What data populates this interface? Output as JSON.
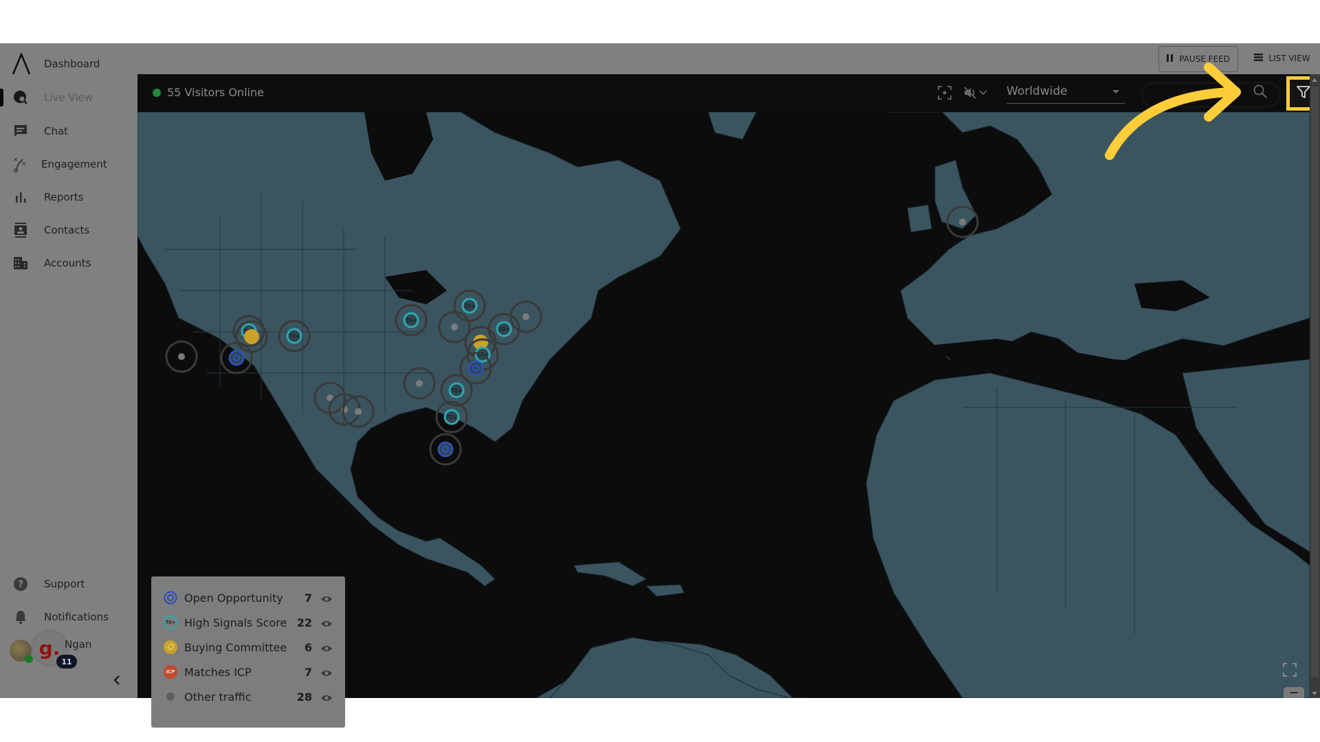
{
  "sidebar": {
    "items": [
      {
        "label": "Dashboard",
        "icon": "logo-icon"
      },
      {
        "label": "Live View",
        "icon": "globe-search-icon",
        "active": true
      },
      {
        "label": "Chat",
        "icon": "chat-icon"
      },
      {
        "label": "Engagement",
        "icon": "strategy-icon"
      },
      {
        "label": "Reports",
        "icon": "bar-chart-icon"
      },
      {
        "label": "Contacts",
        "icon": "contact-card-icon"
      },
      {
        "label": "Accounts",
        "icon": "building-icon"
      }
    ],
    "bottom_items": [
      {
        "label": "Support",
        "icon": "help-icon"
      },
      {
        "label": "Notifications",
        "icon": "bell-icon"
      }
    ],
    "user": {
      "name": "Ngan",
      "brand_letter": "g.",
      "notification_count": "11"
    },
    "collapse_icon": "chevron-left-icon"
  },
  "toolbar": {
    "pause_label": "PAUSE FEED",
    "list_view_label": "LIST VIEW"
  },
  "map_header": {
    "visitors_online": "55 Visitors Online",
    "status_color": "#1f8a3a",
    "region": "Worldwide",
    "search_placeholder": "",
    "filter_tooltip": "Filter"
  },
  "legend": {
    "items": [
      {
        "label": "Open Opportunity",
        "count": "7",
        "icon": "target-icon",
        "color": "#2e50b8"
      },
      {
        "label": "High Signals Score",
        "count": "22",
        "icon": "score-ring-icon",
        "badge": "70+",
        "color": "#2fa8b0"
      },
      {
        "label": "Buying Committee",
        "count": "6",
        "icon": "tag-icon",
        "color": "#c9a227"
      },
      {
        "label": "Matches ICP",
        "count": "7",
        "icon": "icp-icon",
        "badge": "ICP",
        "color": "#c24a2a"
      },
      {
        "label": "Other traffic",
        "count": "28",
        "icon": "dot-icon",
        "color": "#8a8a8a"
      }
    ]
  },
  "map": {
    "land_color": "#3b5560",
    "water_color": "#0c0c0c",
    "accent_highlight": "#ffcd3a",
    "marker_badge": "70+"
  }
}
